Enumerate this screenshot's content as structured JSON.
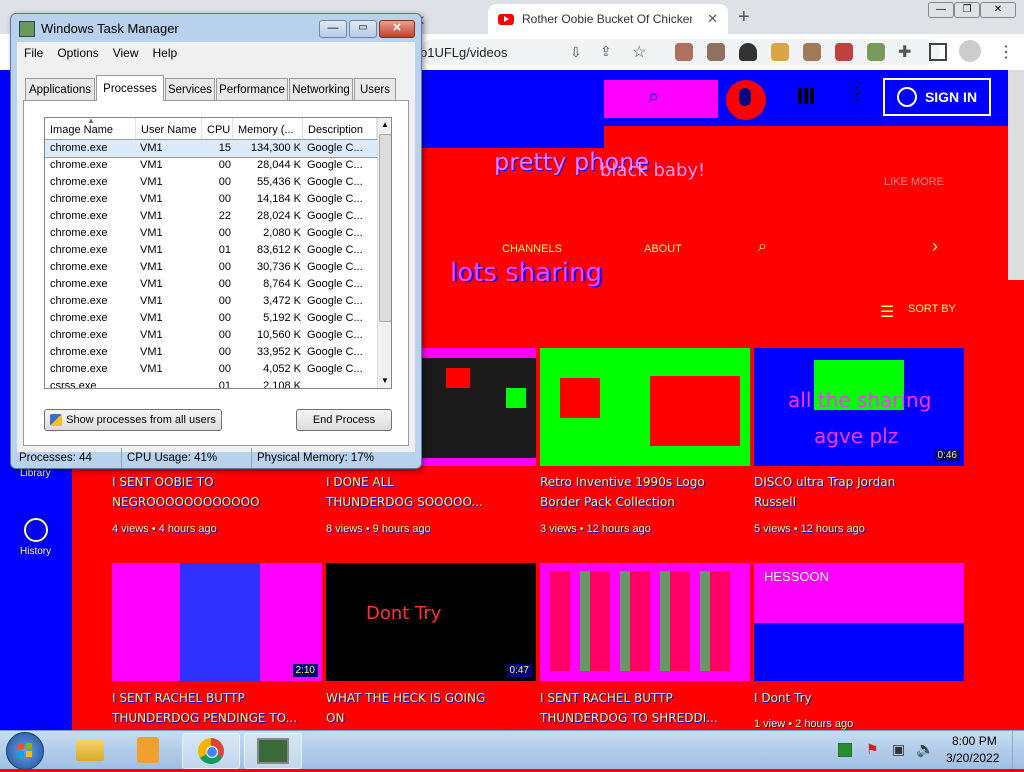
{
  "browser": {
    "tabs": [
      {
        "label": "x"
      },
      {
        "label": "Rother Oobie Bucket Of Chicken"
      }
    ],
    "new_tab": "+",
    "url_fragment": "p1UFLg/videos",
    "window_controls": {
      "minimize": "—",
      "restore": "❐",
      "close": "✕"
    }
  },
  "youtube": {
    "sign_in": "SIGN IN",
    "channel_banner": "pretty phone",
    "banner_sub": "black baby!",
    "banner_right": "LIKE MORE",
    "nav": {
      "channels": "CHANNELS",
      "about": "ABOUT"
    },
    "section_title": "lots sharing",
    "sort_by": "SORT BY",
    "sidebar": [
      {
        "label": "Library"
      },
      {
        "label": "History"
      }
    ],
    "videos": [
      {
        "title_lines": [
          "I SENT OOBIE TO",
          "NEGROOOOOOOOOOOO"
        ],
        "meta": "4 views • 4 hours ago",
        "duration": ""
      },
      {
        "title_lines": [
          "I DONE ALL",
          "THUNDERDOG SOOOOO..."
        ],
        "meta": "8 views • 9 hours ago",
        "duration": ""
      },
      {
        "title_lines": [
          "Retro Inventive 1990s Logo",
          "Border Pack Collection"
        ],
        "meta": "3 views • 12 hours ago",
        "duration": ""
      },
      {
        "title_lines": [
          "DISCO ultra Trap Jordan",
          "Russell"
        ],
        "meta": "5 views • 12 hours ago",
        "duration": "0:46"
      },
      {
        "title_lines": [
          "I SENT RACHEL BUTTP",
          "THUNDERDOG PENDINGE TO..."
        ],
        "meta": "",
        "duration": "2:10"
      },
      {
        "title_lines": [
          "WHAT THE HECK IS GOING",
          "ON"
        ],
        "meta": "",
        "duration": "0:47"
      },
      {
        "title_lines": [
          "I SENT RACHEL BUTTP",
          "THUNDERDOG TO SHREDDI..."
        ],
        "meta": "",
        "duration": ""
      },
      {
        "title_lines": [
          "I Dont Try"
        ],
        "meta": "1 view • 2 hours ago",
        "duration": ""
      }
    ],
    "thumb_overlay_text": [
      "all the sharing",
      "agve plz",
      "Dont Try",
      "HESSOON"
    ]
  },
  "task_manager": {
    "title": "Windows Task Manager",
    "menu": [
      "File",
      "Options",
      "View",
      "Help"
    ],
    "tabs": [
      "Applications",
      "Processes",
      "Services",
      "Performance",
      "Networking",
      "Users"
    ],
    "columns": [
      "Image Name",
      "User Name",
      "CPU",
      "Memory (...",
      "Description"
    ],
    "rows": [
      [
        "chrome.exe",
        "VM1",
        "15",
        "134,300 K",
        "Google C..."
      ],
      [
        "chrome.exe",
        "VM1",
        "00",
        "28,044 K",
        "Google C..."
      ],
      [
        "chrome.exe",
        "VM1",
        "00",
        "55,436 K",
        "Google C..."
      ],
      [
        "chrome.exe",
        "VM1",
        "00",
        "14,184 K",
        "Google C..."
      ],
      [
        "chrome.exe",
        "VM1",
        "22",
        "28,024 K",
        "Google C..."
      ],
      [
        "chrome.exe",
        "VM1",
        "00",
        "2,080 K",
        "Google C..."
      ],
      [
        "chrome.exe",
        "VM1",
        "01",
        "83,612 K",
        "Google C..."
      ],
      [
        "chrome.exe",
        "VM1",
        "00",
        "30,736 K",
        "Google C..."
      ],
      [
        "chrome.exe",
        "VM1",
        "00",
        "8,764 K",
        "Google C..."
      ],
      [
        "chrome.exe",
        "VM1",
        "00",
        "3,472 K",
        "Google C..."
      ],
      [
        "chrome.exe",
        "VM1",
        "00",
        "5,192 K",
        "Google C..."
      ],
      [
        "chrome.exe",
        "VM1",
        "00",
        "10,560 K",
        "Google C..."
      ],
      [
        "chrome.exe",
        "VM1",
        "00",
        "33,952 K",
        "Google C..."
      ],
      [
        "chrome.exe",
        "VM1",
        "00",
        "4,052 K",
        "Google C..."
      ],
      [
        "csrss.exe",
        "",
        "01",
        "2,108 K",
        ""
      ]
    ],
    "show_all_button": "Show processes from all users",
    "end_process_button": "End Process",
    "status": {
      "processes": "Processes: 44",
      "cpu": "CPU Usage: 41%",
      "memory": "Physical Memory: 17%"
    }
  },
  "taskbar": {
    "time": "8:00 PM",
    "date": "3/20/2022"
  },
  "colors": {
    "yt_blue": "#0000ff",
    "yt_red": "#ff0000",
    "tm_frame": "#b8d1ec"
  }
}
